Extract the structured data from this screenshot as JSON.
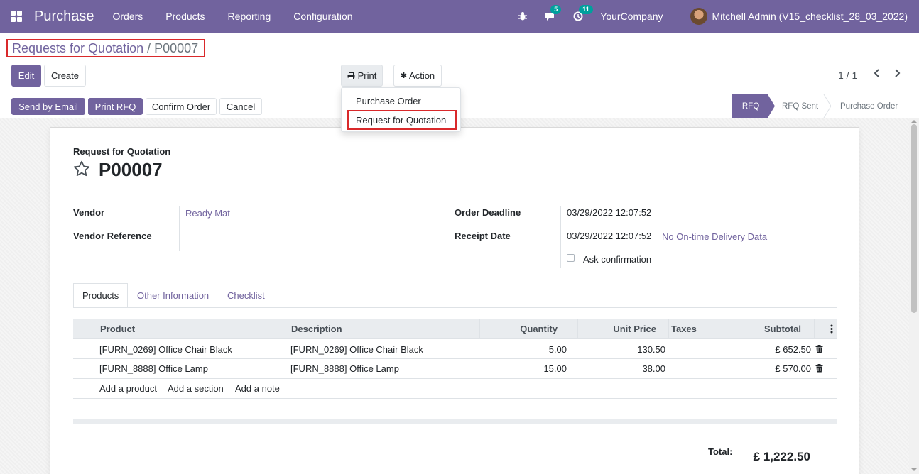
{
  "navbar": {
    "brand": "Purchase",
    "menu": [
      "Orders",
      "Products",
      "Reporting",
      "Configuration"
    ],
    "messages_count": "5",
    "activities_count": "11",
    "company": "YourCompany",
    "user": "Mitchell Admin (V15_checklist_28_03_2022)"
  },
  "breadcrumb": {
    "parent": "Requests for Quotation",
    "separator": "/",
    "current": "P00007"
  },
  "buttons": {
    "edit": "Edit",
    "create": "Create",
    "print": "Print",
    "action": "Action",
    "send_email": "Send by Email",
    "print_rfq": "Print RFQ",
    "confirm_order": "Confirm Order",
    "cancel": "Cancel"
  },
  "pager": {
    "value": "1 / 1"
  },
  "print_menu": {
    "items": [
      "Purchase Order",
      "Request for Quotation"
    ]
  },
  "stages": [
    "RFQ",
    "RFQ Sent",
    "Purchase Order"
  ],
  "form": {
    "doc_type": "Request for Quotation",
    "name": "P00007",
    "vendor_label": "Vendor",
    "vendor_value": "Ready Mat",
    "vendor_ref_label": "Vendor Reference",
    "deadline_label": "Order Deadline",
    "deadline_value": "03/29/2022 12:07:52",
    "receipt_label": "Receipt Date",
    "receipt_value": "03/29/2022 12:07:52",
    "ontime_link": "No On-time Delivery Data",
    "ask_confirmation": "Ask confirmation"
  },
  "tabs": [
    "Products",
    "Other Information",
    "Checklist"
  ],
  "table": {
    "headers": {
      "product": "Product",
      "description": "Description",
      "quantity": "Quantity",
      "unit_price": "Unit Price",
      "taxes": "Taxes",
      "subtotal": "Subtotal"
    },
    "rows": [
      {
        "product": "[FURN_0269] Office Chair Black",
        "description": "[FURN_0269] Office Chair Black",
        "quantity": "5.00",
        "unit_price": "130.50",
        "taxes": "",
        "subtotal": "£ 652.50"
      },
      {
        "product": "[FURN_8888] Office Lamp",
        "description": "[FURN_8888] Office Lamp",
        "quantity": "15.00",
        "unit_price": "38.00",
        "taxes": "",
        "subtotal": "£ 570.00"
      }
    ],
    "add_product": "Add a product",
    "add_section": "Add a section",
    "add_note": "Add a note"
  },
  "totals": {
    "label": "Total:",
    "value": "£ 1,222.50"
  }
}
